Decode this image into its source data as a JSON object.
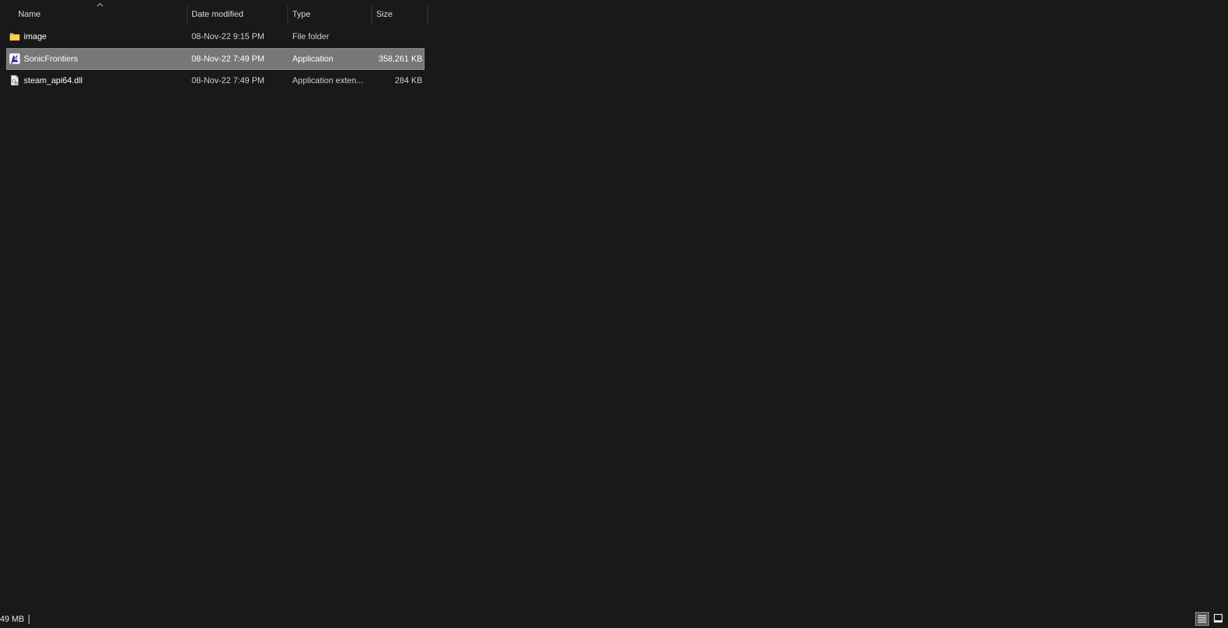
{
  "columns": {
    "name": "Name",
    "date_modified": "Date modified",
    "type": "Type",
    "size": "Size",
    "sort_column": "Name"
  },
  "files": [
    {
      "name": "image",
      "date": "08-Nov-22 9:15 PM",
      "type": "File folder",
      "size": "",
      "icon": "folder-icon",
      "selected": false
    },
    {
      "name": "SonicFrontiers",
      "date": "08-Nov-22 7:49 PM",
      "type": "Application",
      "size": "358,261 KB",
      "icon": "sonic-app-icon",
      "selected": true
    },
    {
      "name": "steam_api64.dll",
      "date": "08-Nov-22 7:49 PM",
      "type": "Application exten...",
      "size": "284 KB",
      "icon": "dll-file-icon",
      "selected": false
    }
  ],
  "status_bar": {
    "text": "49 MB"
  },
  "colors": {
    "background": "#191919",
    "selection": "#777777",
    "folder": "#f4c24a",
    "text": "#ffffff"
  },
  "view_buttons": [
    {
      "icon": "details-view-icon",
      "active": true
    },
    {
      "icon": "large-icons-view-icon",
      "active": false
    }
  ]
}
